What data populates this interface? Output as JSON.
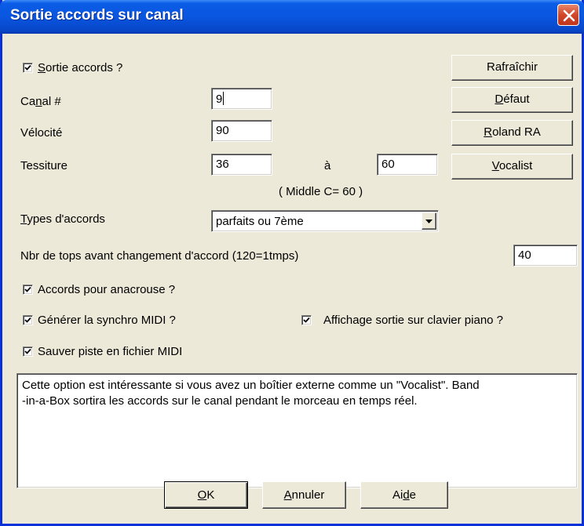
{
  "window": {
    "title": "Sortie accords sur canal"
  },
  "chord_output": {
    "checked": true,
    "label_underline": "S",
    "label_rest": "ortie accords ?"
  },
  "channel": {
    "label_a": "Ca",
    "label_u": "n",
    "label_b": "al #",
    "value": "9"
  },
  "velocity": {
    "label": "Vélocité",
    "value": "90"
  },
  "range": {
    "label": "Tessiture",
    "low": "36",
    "to_label": "à",
    "high": "60",
    "note": "( Middle C= 60 )"
  },
  "chord_types": {
    "label_underline": "T",
    "label_rest": "ypes d'accords",
    "selected": "parfaits ou 7ème"
  },
  "ticks": {
    "label": "Nbr de tops avant changement d'accord (120=1tmps)",
    "value": "40"
  },
  "options": {
    "anacrusis": {
      "checked": true,
      "label": "Accords pour anacrouse ?"
    },
    "midi_sync": {
      "checked": true,
      "label": "Générer la synchro MIDI ?"
    },
    "piano_display": {
      "checked": true,
      "label": "Affichage sortie sur clavier piano ?"
    },
    "save_midi": {
      "checked": true,
      "label": "Sauver piste en fichier MIDI"
    }
  },
  "side_buttons": {
    "refresh": "Rafraîchir",
    "default_u": "D",
    "default_rest": "éfaut",
    "roland_u": "R",
    "roland_rest": "oland RA",
    "vocalist_u": "V",
    "vocalist_rest": "ocalist"
  },
  "description": {
    "line1": "Cette option est intéressante si vous avez un boîtier externe comme un \"Vocalist\". Band",
    "line2": "-in-a-Box  sortira les accords sur le canal pendant le morceau en temps réel."
  },
  "footer": {
    "ok_u": "O",
    "ok_rest": "K",
    "cancel_u": "A",
    "cancel_rest": "nnuler",
    "help_a": "Ai",
    "help_u": "d",
    "help_b": "e"
  },
  "colors": {
    "titlebar": "#0a56e0",
    "face": "#ece9d8",
    "close": "#d2472a"
  },
  "icons": {
    "close": "close-icon",
    "check": "checkmark-icon",
    "dropdown": "chevron-down-icon"
  }
}
